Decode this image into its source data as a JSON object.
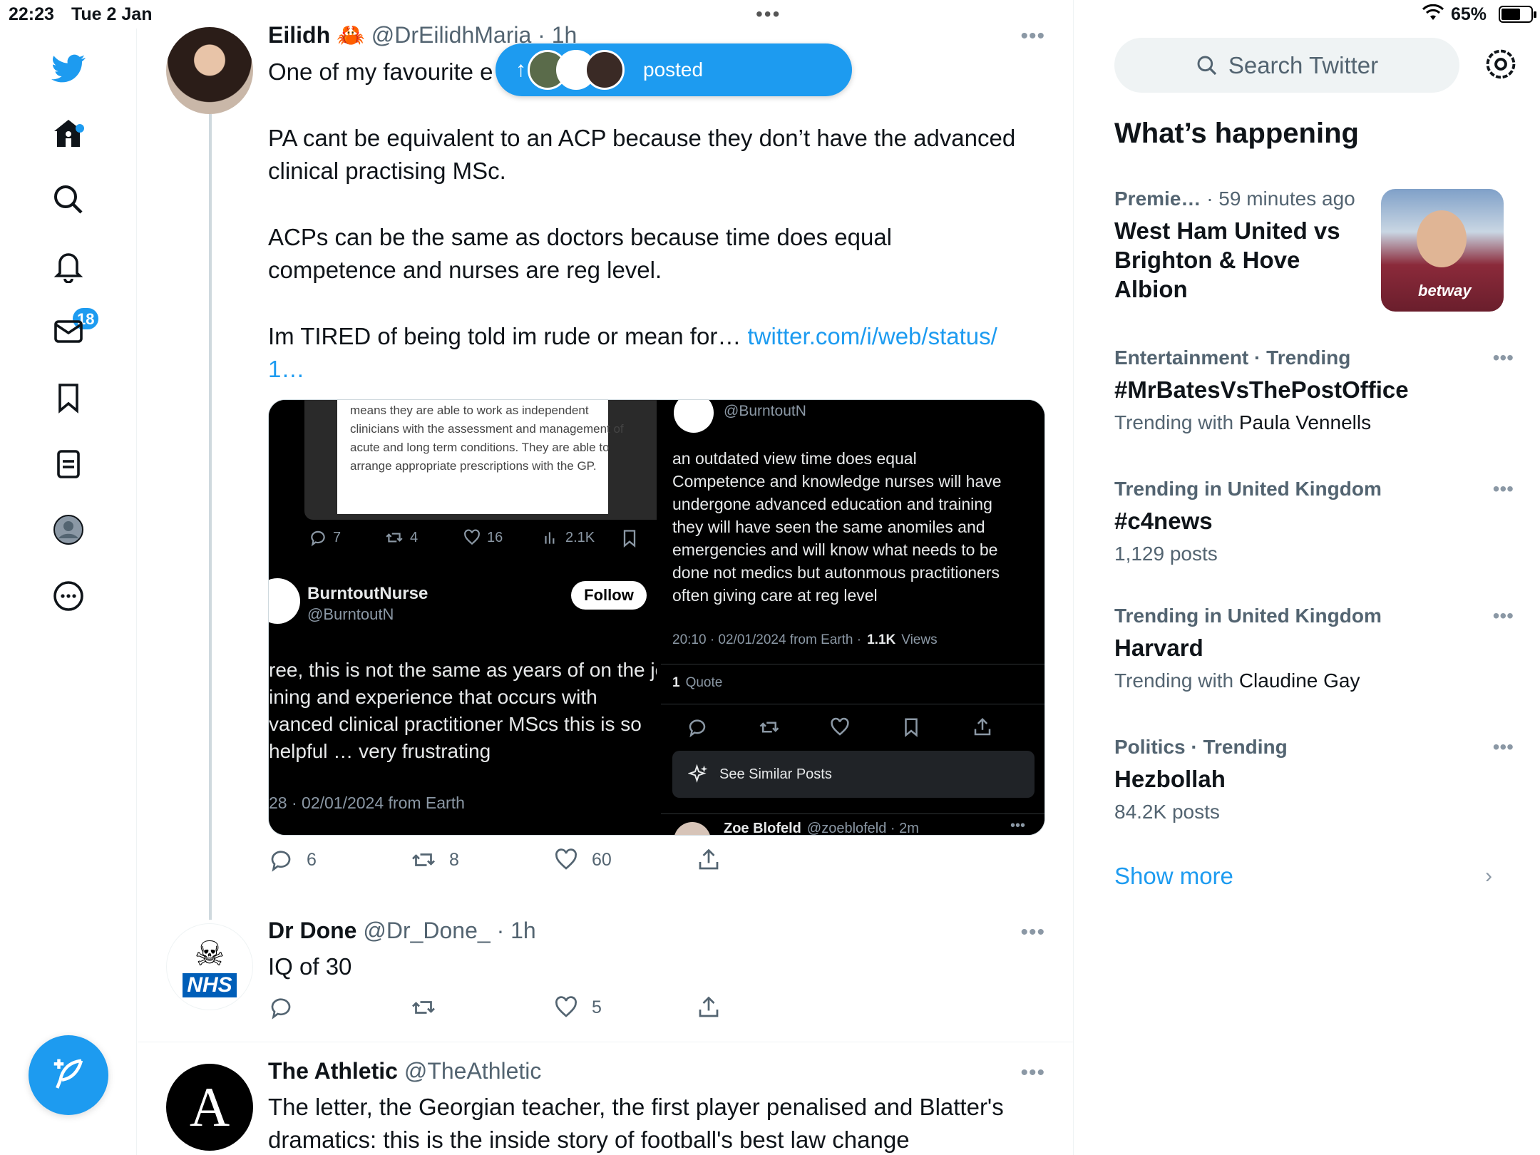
{
  "status": {
    "time": "22:23",
    "date": "Tue 2 Jan",
    "battery": "65%",
    "battery_level": 0.65
  },
  "nav": {
    "notifications_badge": "18"
  },
  "pill": {
    "label": "posted"
  },
  "tweets": [
    {
      "name": "Eilidh",
      "emoji": "🦀",
      "handle": "@DrEilidhMaria",
      "time": "· 1h",
      "text_line1": "One of my favourite e",
      "text_p2": "PA cant be equivalent to an ACP because they don’t have the advanced\nclinical practising MSc.",
      "text_p3": "ACPs can be the same as doctors because time does equal\ncompetence and nurses are reg level.",
      "text_p4": "Im TIRED of being told im rude or mean for…",
      "link_a": "twitter.com/i/web/status/",
      "link_b": "1…",
      "replies": "6",
      "retweets": "8",
      "likes": "60",
      "media": {
        "left": {
          "paper_text": "means they are able to work as independent\nclinicians with the assessment and management of\nacute and long term conditions. They are able to\narrange appropriate prescriptions with the GP.",
          "stat_replies": "7",
          "stat_retweets": "4",
          "stat_likes": "16",
          "stat_views": "2.1K",
          "author_name": "BurntoutNurse",
          "author_handle": "@BurntoutN",
          "follow": "Follow",
          "body": "ree, this is not the same as years of on the jo\nining and experience that occurs with\nvanced clinical practitioner MScs this is so\nhelpful … very frustrating",
          "footer": "28 · 02/01/2024 from Earth"
        },
        "right": {
          "handle_top": "@BurntoutN",
          "body": "an outdated view time does equal\nCompetence and knowledge nurses will have\nundergone advanced education and training\nthey will have seen the same anomiles and\nemergencies and will know what needs to be\ndone not medics but autonmous practitioners\noften giving care at reg level",
          "meta": "20:10 · 02/01/2024 from Earth ·",
          "views_count": "1.1K",
          "views_label": "Views",
          "quote_count": "1",
          "quote_label": "Quote",
          "similar": "See Similar Posts",
          "next_name": "Zoe Blofeld",
          "next_handle": "@zoeblofeld · 2m"
        }
      }
    },
    {
      "name": "Dr Done",
      "handle": "@Dr_Done_",
      "time": "· 1h",
      "text": "IQ of 30",
      "likes": "5",
      "avatar_text": "NHS"
    },
    {
      "name": "The Athletic",
      "handle": "@TheAthletic",
      "text": "The letter, the Georgian teacher, the first player penalised and Blatter's\ndramatics: this is the inside story of football's best law change",
      "avatar_text": "A"
    }
  ],
  "sidebar": {
    "search_placeholder": "Search Twitter",
    "title": "What’s happening",
    "trends": [
      {
        "category": "Premie…",
        "time": "· 59 minutes ago",
        "topic": "West Ham United vs\nBrighton & Hove\nAlbion"
      },
      {
        "category": "Entertainment · Trending",
        "topic": "#MrBatesVsThePostOffice",
        "sub_prefix": "Trending with",
        "sub_name": "Paula Vennells"
      },
      {
        "category": "Trending in United Kingdom",
        "topic": "#c4news",
        "sub": "1,129 posts"
      },
      {
        "category": "Trending in United Kingdom",
        "topic": "Harvard",
        "sub_prefix": "Trending with",
        "sub_name": "Claudine Gay"
      },
      {
        "category": "Politics · Trending",
        "topic": "Hezbollah",
        "sub": "84.2K posts"
      }
    ],
    "show_more": "Show more",
    "trend_image_text": "betway"
  },
  "colors": {
    "accent": "#1d9bf0",
    "text": "#0f1419",
    "muted": "#536471"
  }
}
